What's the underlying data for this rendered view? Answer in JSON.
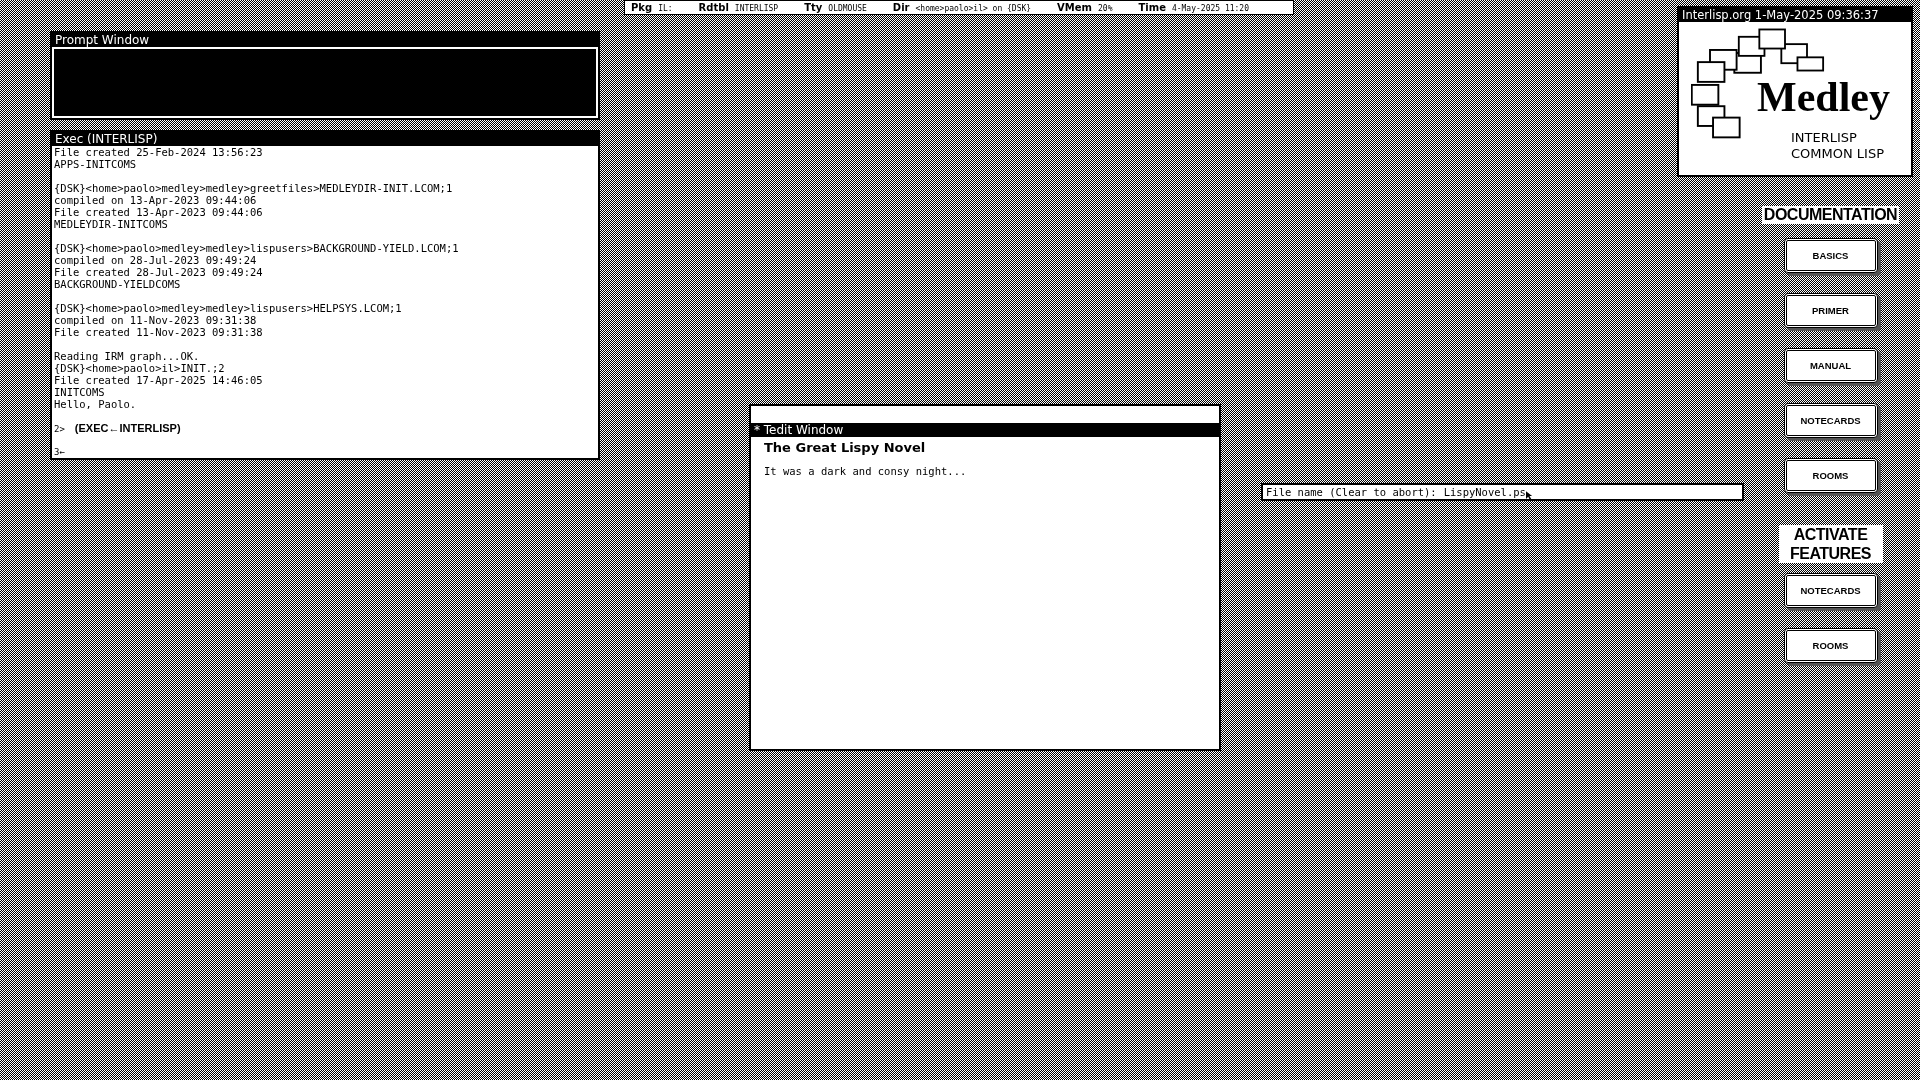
{
  "status_bar": [
    {
      "label": "Pkg",
      "value": "IL:"
    },
    {
      "label": "Rdtbl",
      "value": "INTERLISP"
    },
    {
      "label": "Tty",
      "value": "OLDMOUSE"
    },
    {
      "label": "Dir",
      "value": "<home>paolo>il> on {DSK}"
    },
    {
      "label": "VMem",
      "value": "20%"
    },
    {
      "label": "Time",
      "value": "4-May-2025 11:20"
    }
  ],
  "prompt_window": {
    "title": "Prompt Window"
  },
  "exec_window": {
    "title": "Exec (INTERLISP)",
    "lines": [
      {
        "kind": "text",
        "text": "File created 25-Feb-2024 13:56:23"
      },
      {
        "kind": "text",
        "text": "APPS-INITCOMS"
      },
      {
        "kind": "blank"
      },
      {
        "kind": "text",
        "text": "{DSK}<home>paolo>medley>medley>greetfiles>MEDLEYDIR-INIT.LCOM;1"
      },
      {
        "kind": "text",
        "text": "compiled on 13-Apr-2023 09:44:06"
      },
      {
        "kind": "text",
        "text": "File created 13-Apr-2023 09:44:06"
      },
      {
        "kind": "text",
        "text": "MEDLEYDIR-INITCOMS"
      },
      {
        "kind": "blank"
      },
      {
        "kind": "text",
        "text": "{DSK}<home>paolo>medley>medley>lispusers>BACKGROUND-YIELD.LCOM;1"
      },
      {
        "kind": "text",
        "text": "compiled on 28-Jul-2023 09:49:24"
      },
      {
        "kind": "text",
        "text": "File created 28-Jul-2023 09:49:24"
      },
      {
        "kind": "text",
        "text": "BACKGROUND-YIELDCOMS"
      },
      {
        "kind": "blank"
      },
      {
        "kind": "text",
        "text": "{DSK}<home>paolo>medley>medley>lispusers>HELPSYS.LCOM;1"
      },
      {
        "kind": "text",
        "text": "compiled on 11-Nov-2023 09:31:38"
      },
      {
        "kind": "text",
        "text": "File created 11-Nov-2023 09:31:38"
      },
      {
        "kind": "blank"
      },
      {
        "kind": "text",
        "text": "Reading IRM graph...OK."
      },
      {
        "kind": "text",
        "text": "{DSK}<home>paolo>il>INIT.;2"
      },
      {
        "kind": "text",
        "text": "File created 17-Apr-2025 14:46:05"
      },
      {
        "kind": "text",
        "text": "INITCOMS"
      },
      {
        "kind": "text",
        "text": "Hello, Paolo."
      },
      {
        "kind": "blank"
      },
      {
        "kind": "prompt",
        "number": "2>",
        "text": "(EXEC←INTERLISP)"
      },
      {
        "kind": "blank"
      },
      {
        "kind": "prompt",
        "number": "3←"
      }
    ]
  },
  "logo_window": {
    "title": "Interlisp.org  1-May-2025 09:36:37",
    "name": "Medley",
    "subtitles": [
      "INTERLISP",
      "COMMON LISP"
    ]
  },
  "documentation": {
    "heading": "DOCUMENTATION",
    "buttons": [
      "BASICS",
      "PRIMER",
      "MANUAL",
      "NOTECARDS",
      "ROOMS"
    ]
  },
  "features": {
    "heading": "ACTIVATE FEATURES",
    "buttons": [
      "NOTECARDS",
      "ROOMS"
    ]
  },
  "tedit_window": {
    "title": "* Tedit Window",
    "heading": "The Great Lispy Novel",
    "body": "It was a dark and consy night..."
  },
  "file_prompt": {
    "label": "File name (Clear to abort):",
    "value": "LispyNovel.ps"
  }
}
